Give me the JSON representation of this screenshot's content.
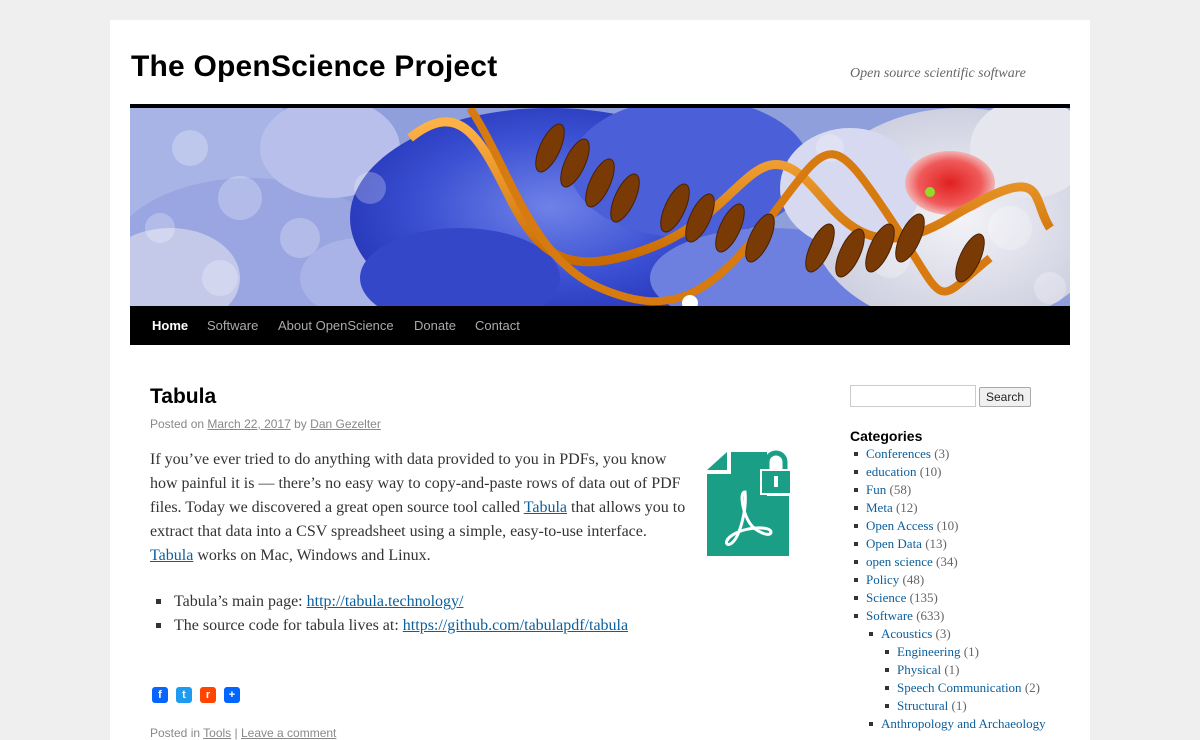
{
  "site": {
    "title": "The OpenScience Project",
    "description": "Open source scientific software"
  },
  "nav": {
    "items": [
      {
        "label": "Home",
        "current": true
      },
      {
        "label": "Software",
        "current": false
      },
      {
        "label": "About OpenScience",
        "current": false
      },
      {
        "label": "Donate",
        "current": false
      },
      {
        "label": "Contact",
        "current": false
      }
    ]
  },
  "post": {
    "title": "Tabula",
    "meta": {
      "posted_on": "Posted on",
      "date": "March 22, 2017",
      "by": "by",
      "author": "Dan Gezelter"
    },
    "body": {
      "text1": "If you’ve ever tried to do anything with data provided to you in PDFs, you know how painful it is — there’s no easy way to copy-and-paste rows of data out of PDF files.  Today we discovered a great open source tool called ",
      "link1": "Tabula",
      "text2": " that allows you to extract that data into a CSV spreadsheet using a simple, easy-to-use interface. ",
      "link2": "Tabula",
      "text3": " works on Mac, Windows and Linux."
    },
    "list": [
      {
        "text": "Tabula’s main page: ",
        "link": "http://tabula.technology/"
      },
      {
        "text": "The source code for tabula lives at: ",
        "link": "https://github.com/tabulapdf/tabula"
      }
    ],
    "share_icons": [
      {
        "icon": "facebook-icon",
        "glyph": "f",
        "color": "#0866ff"
      },
      {
        "icon": "twitter-icon",
        "glyph": "t",
        "color": "#1d9bf0"
      },
      {
        "icon": "reddit-icon",
        "glyph": "r",
        "color": "#ff4500"
      },
      {
        "icon": "share-icon",
        "glyph": "+",
        "color": "#0166ff"
      }
    ],
    "utility": {
      "posted_in": "Posted in",
      "category": "Tools",
      "separator": "|",
      "comment": "Leave a comment"
    }
  },
  "sidebar": {
    "search_button": "Search",
    "search_value": "",
    "categories_title": "Categories",
    "categories": [
      {
        "name": "Conferences",
        "count": "(3)",
        "level": 0
      },
      {
        "name": "education",
        "count": "(10)",
        "level": 0
      },
      {
        "name": "Fun",
        "count": "(58)",
        "level": 0
      },
      {
        "name": "Meta",
        "count": "(12)",
        "level": 0
      },
      {
        "name": "Open Access",
        "count": "(10)",
        "level": 0
      },
      {
        "name": "Open Data",
        "count": "(13)",
        "level": 0
      },
      {
        "name": "open science",
        "count": "(34)",
        "level": 0
      },
      {
        "name": "Policy",
        "count": "(48)",
        "level": 0
      },
      {
        "name": "Science",
        "count": "(135)",
        "level": 0
      },
      {
        "name": "Software",
        "count": "(633)",
        "level": 0
      },
      {
        "name": "Acoustics",
        "count": "(3)",
        "level": 1
      },
      {
        "name": "Engineering",
        "count": "(1)",
        "level": 2
      },
      {
        "name": "Physical",
        "count": "(1)",
        "level": 2
      },
      {
        "name": "Speech Communication",
        "count": "(2)",
        "level": 2
      },
      {
        "name": "Structural",
        "count": "(1)",
        "level": 2
      },
      {
        "name": "Anthropology and Archaeology",
        "count": "",
        "level": 1
      }
    ]
  },
  "colors": {
    "link": "#0b5f9d",
    "pdf_icon": "#1a9f86",
    "nav_bg": "#000000"
  }
}
